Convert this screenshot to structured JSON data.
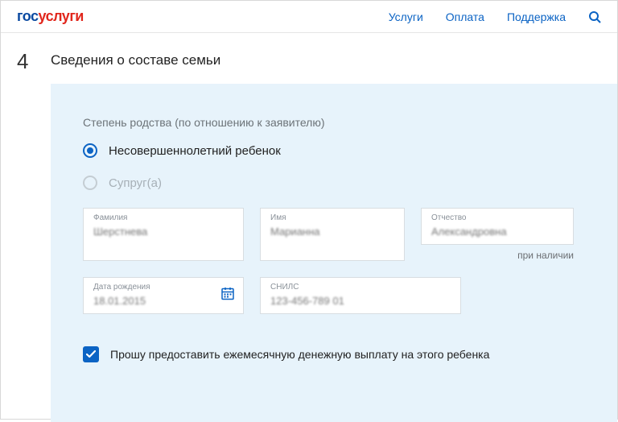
{
  "logo": {
    "part1": "гос",
    "part2": "услуги"
  },
  "nav": {
    "services": "Услуги",
    "payment": "Оплата",
    "support": "Поддержка"
  },
  "step": {
    "number": "4",
    "title": "Сведения о составе семьи"
  },
  "relation": {
    "label": "Степень родства (по отношению к заявителю)",
    "opt_child": "Несовершеннолетний ребенок",
    "opt_spouse": "Супруг(а)"
  },
  "fields": {
    "lastname_label": "Фамилия",
    "lastname_value": "Шерстнева",
    "firstname_label": "Имя",
    "firstname_value": "Марианна",
    "patronymic_label": "Отчество",
    "patronymic_value": "Александровна",
    "patronymic_hint": "при наличии",
    "dob_label": "Дата рождения",
    "dob_value": "18.01.2015",
    "snils_label": "СНИЛС",
    "snils_value": "123-456-789 01"
  },
  "checkbox": {
    "label": "Прошу предоставить ежемесячную денежную выплату на этого ребенка"
  },
  "colors": {
    "accent": "#0b63c4"
  }
}
